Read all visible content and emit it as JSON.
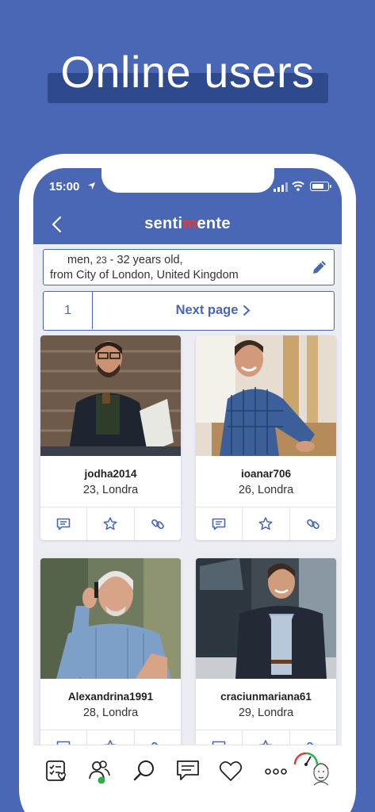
{
  "headline": "Online users",
  "status_bar": {
    "time": "15:00"
  },
  "header": {
    "logo_left": "senti",
    "logo_heart": "m",
    "logo_right": "ente"
  },
  "filter": {
    "line1_prefix": "men,",
    "age_min": "23",
    "line1_suffix": "- 32 years old,",
    "line2": "from City of London, United Kingdom"
  },
  "pager": {
    "current_page": "1",
    "next_label": "Next page"
  },
  "users": [
    {
      "name": "jodha2014",
      "info": "23, Londra"
    },
    {
      "name": "ioanar706",
      "info": "26, Londra"
    },
    {
      "name": "Alexandrina1991",
      "info": "28, Londra"
    },
    {
      "name": "craciunmariana61",
      "info": "29, Londra"
    }
  ],
  "icons": {
    "back": "chevron-left-icon",
    "edit": "pencil-icon",
    "card_actions": [
      "message-icon",
      "star-icon",
      "link-icon"
    ],
    "bottom_nav": [
      "checklist-icon",
      "users-online-icon",
      "search-icon",
      "messages-icon",
      "heart-icon",
      "more-icon",
      "profile-speedometer-icon"
    ]
  },
  "colors": {
    "brand": "#4a67b5",
    "heart": "#e23a3a",
    "online": "#2fae4e"
  }
}
